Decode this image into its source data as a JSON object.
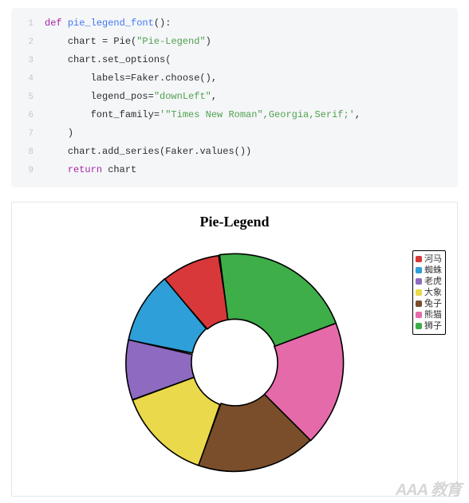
{
  "code": {
    "lines": [
      {
        "n": "1",
        "indent": "",
        "tokens": [
          {
            "cls": "tok-kw",
            "t": "def "
          },
          {
            "cls": "tok-fn",
            "t": "pie_legend_font"
          },
          {
            "cls": "tok-par",
            "t": "():"
          }
        ]
      },
      {
        "n": "2",
        "indent": "    ",
        "tokens": [
          {
            "cls": "tok-plain",
            "t": "chart = Pie("
          },
          {
            "cls": "tok-str",
            "t": "\"Pie-Legend\""
          },
          {
            "cls": "tok-plain",
            "t": ")"
          }
        ]
      },
      {
        "n": "3",
        "indent": "    ",
        "tokens": [
          {
            "cls": "tok-plain",
            "t": "chart.set_options("
          }
        ]
      },
      {
        "n": "4",
        "indent": "        ",
        "tokens": [
          {
            "cls": "tok-plain",
            "t": "labels=Faker.choose(),"
          }
        ]
      },
      {
        "n": "5",
        "indent": "        ",
        "tokens": [
          {
            "cls": "tok-plain",
            "t": "legend_pos="
          },
          {
            "cls": "tok-str",
            "t": "\"downLeft\""
          },
          {
            "cls": "tok-plain",
            "t": ","
          }
        ]
      },
      {
        "n": "6",
        "indent": "        ",
        "tokens": [
          {
            "cls": "tok-plain",
            "t": "font_family="
          },
          {
            "cls": "tok-str",
            "t": "'\"Times New Roman\",Georgia,Serif;'"
          },
          {
            "cls": "tok-plain",
            "t": ","
          }
        ]
      },
      {
        "n": "7",
        "indent": "    ",
        "tokens": [
          {
            "cls": "tok-plain",
            "t": ")"
          }
        ]
      },
      {
        "n": "8",
        "indent": "    ",
        "tokens": [
          {
            "cls": "tok-plain",
            "t": "chart.add_series(Faker.values())"
          }
        ]
      },
      {
        "n": "9",
        "indent": "    ",
        "tokens": [
          {
            "cls": "tok-kw",
            "t": "return "
          },
          {
            "cls": "tok-plain",
            "t": "chart"
          }
        ]
      }
    ]
  },
  "chart_data": {
    "type": "pie",
    "title": "Pie-Legend",
    "font_family": "\"Times New Roman\",Georgia,Serif",
    "legend_pos": "top-right",
    "donut_inner_ratio": 0.4,
    "series": [
      {
        "name": "河马",
        "value": 10,
        "color": "#d8383a"
      },
      {
        "name": "蜘蛛",
        "value": 12,
        "color": "#2e9fd9"
      },
      {
        "name": "老虎",
        "value": 10,
        "color": "#8e6ac0"
      },
      {
        "name": "大象",
        "value": 16,
        "color": "#ead94b"
      },
      {
        "name": "兔子",
        "value": 20,
        "color": "#7a4e2b"
      },
      {
        "name": "熊猫",
        "value": 21,
        "color": "#e56aa9"
      },
      {
        "name": "狮子",
        "value": 24,
        "color": "#3eae49"
      }
    ]
  },
  "watermark": "AAA 教育"
}
